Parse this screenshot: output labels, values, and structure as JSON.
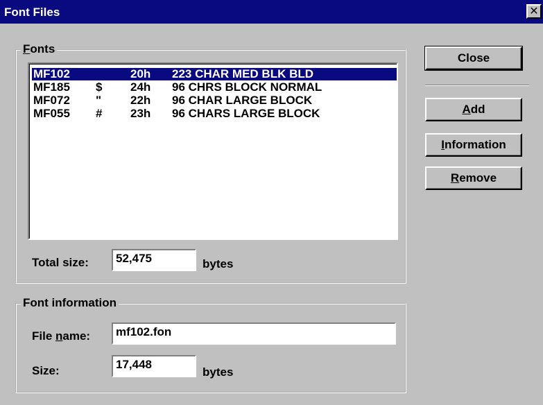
{
  "window": {
    "title": "Font Files",
    "close_glyph": "✕"
  },
  "fonts_group": {
    "label_mnemonic": "F",
    "label_rest": "onts",
    "items": [
      {
        "name": "MF102",
        "char": "",
        "code": "20h",
        "desc": "223 CHAR MED BLK BLD",
        "selected": true
      },
      {
        "name": "MF185",
        "char": "$",
        "code": "24h",
        "desc": "96 CHRS BLOCK NORMAL",
        "selected": false
      },
      {
        "name": "MF072",
        "char": "\"",
        "code": "22h",
        "desc": "96 CHAR LARGE BLOCK",
        "selected": false
      },
      {
        "name": "MF055",
        "char": "#",
        "code": "23h",
        "desc": "96 CHARS LARGE BLOCK",
        "selected": false
      }
    ],
    "total_size_label": "Total size:",
    "total_size_value": "52,475",
    "total_size_unit": "bytes"
  },
  "info_group": {
    "label": "Font information",
    "file_name_label_pre": "File ",
    "file_name_label_mnemonic": "n",
    "file_name_label_post": "ame:",
    "file_name_value": "mf102.fon",
    "size_label": "Size:",
    "size_value": "17,448",
    "size_unit": "bytes"
  },
  "buttons": {
    "close": "Close",
    "add_mnemonic": "A",
    "add_rest": "dd",
    "info_mnemonic": "I",
    "info_rest": "nformation",
    "remove_mnemonic": "R",
    "remove_rest": "emove"
  }
}
